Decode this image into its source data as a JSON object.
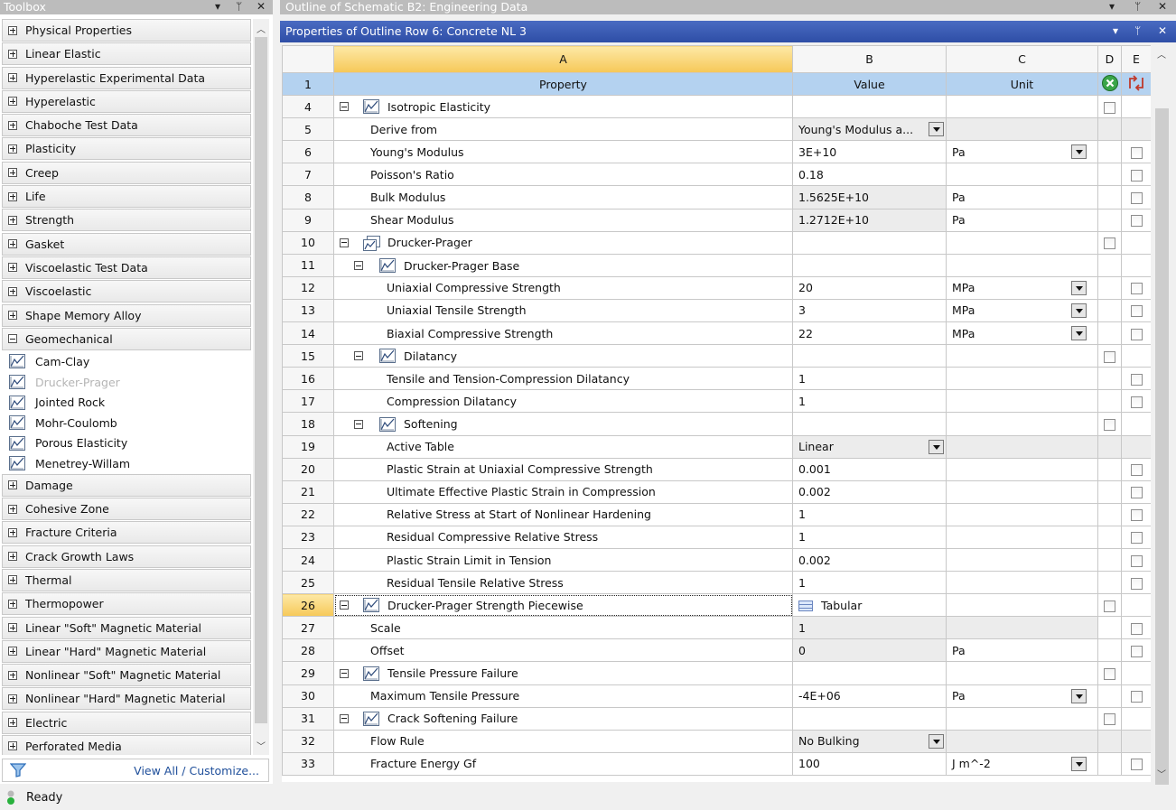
{
  "toolbox": {
    "title": "Toolbox",
    "categories_top": [
      "Physical Properties",
      "Linear Elastic",
      "Hyperelastic Experimental Data",
      "Hyperelastic",
      "Chaboche Test Data",
      "Plasticity",
      "Creep",
      "Life",
      "Strength",
      "Gasket",
      "Viscoelastic Test Data",
      "Viscoelastic",
      "Shape Memory Alloy"
    ],
    "expanded_category": "Geomechanical",
    "sub_items": [
      "Cam-Clay",
      "Drucker-Prager",
      "Jointed Rock",
      "Mohr-Coulomb",
      "Porous Elasticity",
      "Menetrey-Willam"
    ],
    "disabled_sub_item_index": 1,
    "categories_bottom": [
      "Damage",
      "Cohesive Zone",
      "Fracture Criteria",
      "Crack Growth Laws",
      "Thermal",
      "Thermopower",
      "Linear \"Soft\" Magnetic Material",
      "Linear \"Hard\" Magnetic Material",
      "Nonlinear \"Soft\" Magnetic Material",
      "Nonlinear \"Hard\" Magnetic Material",
      "Electric",
      "Perforated Media"
    ],
    "footer_link": "View All / Customize..."
  },
  "outline": {
    "title": "Outline of Schematic B2: Engineering Data"
  },
  "properties": {
    "title": "Properties of Outline Row 6: Concrete NL 3",
    "col_letters": [
      "A",
      "B",
      "C",
      "D",
      "E"
    ],
    "col_headers": [
      "Property",
      "Value",
      "Unit"
    ],
    "header_row_num": "1",
    "rows": [
      {
        "n": "4",
        "label": "Isotropic Elasticity",
        "group": true,
        "level": 0,
        "icon": "elastic",
        "d": true
      },
      {
        "n": "5",
        "label": "Derive from",
        "level": 1,
        "value": "Young's Modulus a...",
        "value_dd": true,
        "gray": true
      },
      {
        "n": "6",
        "label": "Young's Modulus",
        "level": 1,
        "value": "3E+10",
        "unit": "Pa",
        "unit_dd": true,
        "e": true
      },
      {
        "n": "7",
        "label": "Poisson's Ratio",
        "level": 1,
        "value": "0.18",
        "e": true
      },
      {
        "n": "8",
        "label": "Bulk Modulus",
        "level": 1,
        "value": "1.5625E+10",
        "unit": "Pa",
        "gray": true,
        "e": true
      },
      {
        "n": "9",
        "label": "Shear Modulus",
        "level": 1,
        "value": "1.2712E+10",
        "unit": "Pa",
        "gray": true,
        "e": true
      },
      {
        "n": "10",
        "label": "Drucker-Prager",
        "group": true,
        "level": 0,
        "icon": "multi",
        "d": true
      },
      {
        "n": "11",
        "label": "Drucker-Prager Base",
        "group": true,
        "level": 1,
        "icon": "elastic"
      },
      {
        "n": "12",
        "label": "Uniaxial Compressive Strength",
        "level": 2,
        "value": "20",
        "unit": "MPa",
        "unit_dd": true,
        "e": true
      },
      {
        "n": "13",
        "label": "Uniaxial Tensile Strength",
        "level": 2,
        "value": "3",
        "unit": "MPa",
        "unit_dd": true,
        "e": true
      },
      {
        "n": "14",
        "label": "Biaxial Compressive Strength",
        "level": 2,
        "value": "22",
        "unit": "MPa",
        "unit_dd": true,
        "e": true
      },
      {
        "n": "15",
        "label": "Dilatancy",
        "group": true,
        "level": 1,
        "icon": "elastic",
        "d": true
      },
      {
        "n": "16",
        "label": "Tensile and Tension-Compression Dilatancy",
        "level": 2,
        "value": "1",
        "e": true
      },
      {
        "n": "17",
        "label": "Compression Dilatancy",
        "level": 2,
        "value": "1",
        "e": true
      },
      {
        "n": "18",
        "label": "Softening",
        "group": true,
        "level": 1,
        "icon": "elastic",
        "d": true
      },
      {
        "n": "19",
        "label": "Active Table",
        "level": 2,
        "value": "Linear",
        "value_dd": true,
        "gray": true
      },
      {
        "n": "20",
        "label": "Plastic Strain at Uniaxial Compressive Strength",
        "level": 2,
        "value": "0.001",
        "e": true
      },
      {
        "n": "21",
        "label": "Ultimate Effective Plastic Strain in Compression",
        "level": 2,
        "value": "0.002",
        "e": true
      },
      {
        "n": "22",
        "label": "Relative Stress at Start of Nonlinear Hardening",
        "level": 2,
        "value": "1",
        "e": true
      },
      {
        "n": "23",
        "label": "Residual Compressive Relative Stress",
        "level": 2,
        "value": "1",
        "e": true
      },
      {
        "n": "24",
        "label": "Plastic Strain Limit in Tension",
        "level": 2,
        "value": "0.002",
        "e": true
      },
      {
        "n": "25",
        "label": "Residual Tensile Relative Stress",
        "level": 2,
        "value": "1",
        "e": true
      },
      {
        "n": "26",
        "label": "Drucker-Prager Strength Piecewise",
        "group": true,
        "level": 0,
        "icon": "elastic",
        "value": "Tabular",
        "tabular": true,
        "selected": true,
        "d": true
      },
      {
        "n": "27",
        "label": "Scale",
        "level": 1,
        "value": "1",
        "gray": true,
        "e": true
      },
      {
        "n": "28",
        "label": "Offset",
        "level": 1,
        "value": "0",
        "unit": "Pa",
        "gray": true,
        "e": true
      },
      {
        "n": "29",
        "label": "Tensile Pressure Failure",
        "group": true,
        "level": 0,
        "icon": "elastic",
        "d": true
      },
      {
        "n": "30",
        "label": "Maximum Tensile Pressure",
        "level": 1,
        "value": "-4E+06",
        "unit": "Pa",
        "unit_dd": true,
        "e": true
      },
      {
        "n": "31",
        "label": "Crack Softening Failure",
        "group": true,
        "level": 0,
        "icon": "elastic",
        "d": true
      },
      {
        "n": "32",
        "label": "Flow Rule",
        "level": 1,
        "value": "No Bulking",
        "value_dd": true,
        "gray": true
      },
      {
        "n": "33",
        "label": "Fracture Energy Gf",
        "level": 1,
        "value": "100",
        "unit": "J m^-2",
        "unit_dd": true,
        "e": true
      }
    ]
  },
  "status": {
    "text": "Ready"
  }
}
